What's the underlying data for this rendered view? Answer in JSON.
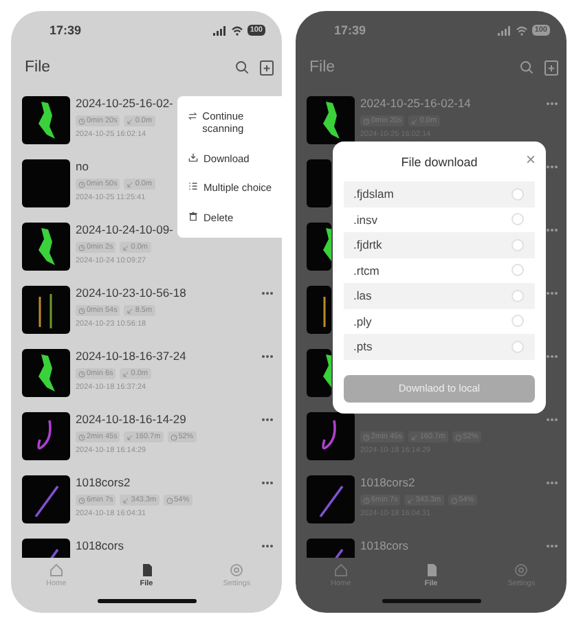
{
  "screens": [
    {
      "kind": "menu",
      "status": {
        "time": "17:39",
        "battery": "100"
      },
      "header": {
        "title": "File"
      },
      "rows": [
        {
          "kind": "figure",
          "title": "2024-10-25-16-02-",
          "tags": [
            {
              "kind": "time",
              "text": "0min 20s"
            },
            {
              "kind": "distance",
              "text": "0.0m"
            }
          ],
          "date": "2024-10-25 16:02:14"
        },
        {
          "kind": "blank",
          "title": "no",
          "tags": [
            {
              "kind": "time",
              "text": "0min 50s"
            },
            {
              "kind": "distance",
              "text": "0.0m"
            }
          ],
          "date": "2024-10-25 11:25:41"
        },
        {
          "kind": "figure",
          "title": "2024-10-24-10-09-",
          "tags": [
            {
              "kind": "time",
              "text": "0min 2s"
            },
            {
              "kind": "distance",
              "text": "0.0m"
            }
          ],
          "date": "2024-10-24 10:09:27"
        },
        {
          "kind": "streaks",
          "title": "2024-10-23-10-56-18",
          "tags": [
            {
              "kind": "time",
              "text": "0min 54s"
            },
            {
              "kind": "distance",
              "text": "8.5m"
            }
          ],
          "date": "2024-10-23 10:56:18"
        },
        {
          "kind": "figure",
          "title": "2024-10-18-16-37-24",
          "tags": [
            {
              "kind": "time",
              "text": "0min 6s"
            },
            {
              "kind": "distance",
              "text": "0.0m"
            }
          ],
          "date": "2024-10-18 16:37:24"
        },
        {
          "kind": "curve",
          "title": "2024-10-18-16-14-29",
          "tags": [
            {
              "kind": "time",
              "text": "2min 45s"
            },
            {
              "kind": "distance",
              "text": "160.7m"
            },
            {
              "kind": "percent",
              "text": "52%"
            }
          ],
          "date": "2024-10-18 16:14:29"
        },
        {
          "kind": "line",
          "title": "1018cors2",
          "tags": [
            {
              "kind": "time",
              "text": "6min 7s"
            },
            {
              "kind": "distance",
              "text": "343.3m"
            },
            {
              "kind": "percent",
              "text": "54%"
            }
          ],
          "date": "2024-10-18 16:04:31"
        },
        {
          "kind": "line",
          "title": "1018cors"
        }
      ],
      "menu": [
        {
          "kind": "scan",
          "label": "Continue scanning"
        },
        {
          "kind": "download",
          "label": "Download"
        },
        {
          "kind": "list",
          "label": "Multiple choice"
        },
        {
          "kind": "trash",
          "label": "Delete"
        }
      ],
      "tabs": [
        {
          "kind": "home",
          "label": "Home",
          "selected": false
        },
        {
          "kind": "file",
          "label": "File",
          "selected": true
        },
        {
          "kind": "settings",
          "label": "Settings",
          "selected": false
        }
      ]
    },
    {
      "kind": "dialog",
      "status": {
        "time": "17:39",
        "battery": "100"
      },
      "header": {
        "title": "File"
      },
      "rows": [
        {
          "kind": "figure",
          "title": "2024-10-25-16-02-14",
          "tags": [
            {
              "kind": "time",
              "text": "0min 20s"
            },
            {
              "kind": "distance",
              "text": "0.0m"
            }
          ],
          "date": "2024-10-25 16:02:14"
        },
        {
          "kind": "blank"
        },
        {
          "kind": "figure"
        },
        {
          "kind": "streaks"
        },
        {
          "kind": "figure"
        },
        {
          "kind": "curve",
          "tags": [
            {
              "kind": "time",
              "text": "2min 45s"
            },
            {
              "kind": "distance",
              "text": "160.7m"
            },
            {
              "kind": "percent",
              "text": "52%"
            }
          ],
          "date": "2024-10-18 16:14:29"
        },
        {
          "kind": "line",
          "title": "1018cors2",
          "tags": [
            {
              "kind": "time",
              "text": "6min 7s"
            },
            {
              "kind": "distance",
              "text": "343.3m"
            },
            {
              "kind": "percent",
              "text": "54%"
            }
          ],
          "date": "2024-10-18 16:04:31"
        },
        {
          "kind": "line",
          "title": "1018cors"
        }
      ],
      "dialog": {
        "title": "File download",
        "options": [
          {
            "label": ".fjdslam",
            "selected": false
          },
          {
            "label": ".insv",
            "selected": false
          },
          {
            "label": ".fjdrtk",
            "selected": false
          },
          {
            "label": ".rtcm",
            "selected": false
          },
          {
            "label": ".las",
            "selected": false
          },
          {
            "label": ".ply",
            "selected": false
          },
          {
            "label": ".pts",
            "selected": false
          }
        ],
        "button": {
          "label": "Downlaod to local",
          "disabled": true
        }
      },
      "tabs": [
        {
          "kind": "home",
          "label": "Home",
          "selected": false
        },
        {
          "kind": "file",
          "label": "File",
          "selected": true
        },
        {
          "kind": "settings",
          "label": "Settings",
          "selected": false
        }
      ]
    }
  ]
}
